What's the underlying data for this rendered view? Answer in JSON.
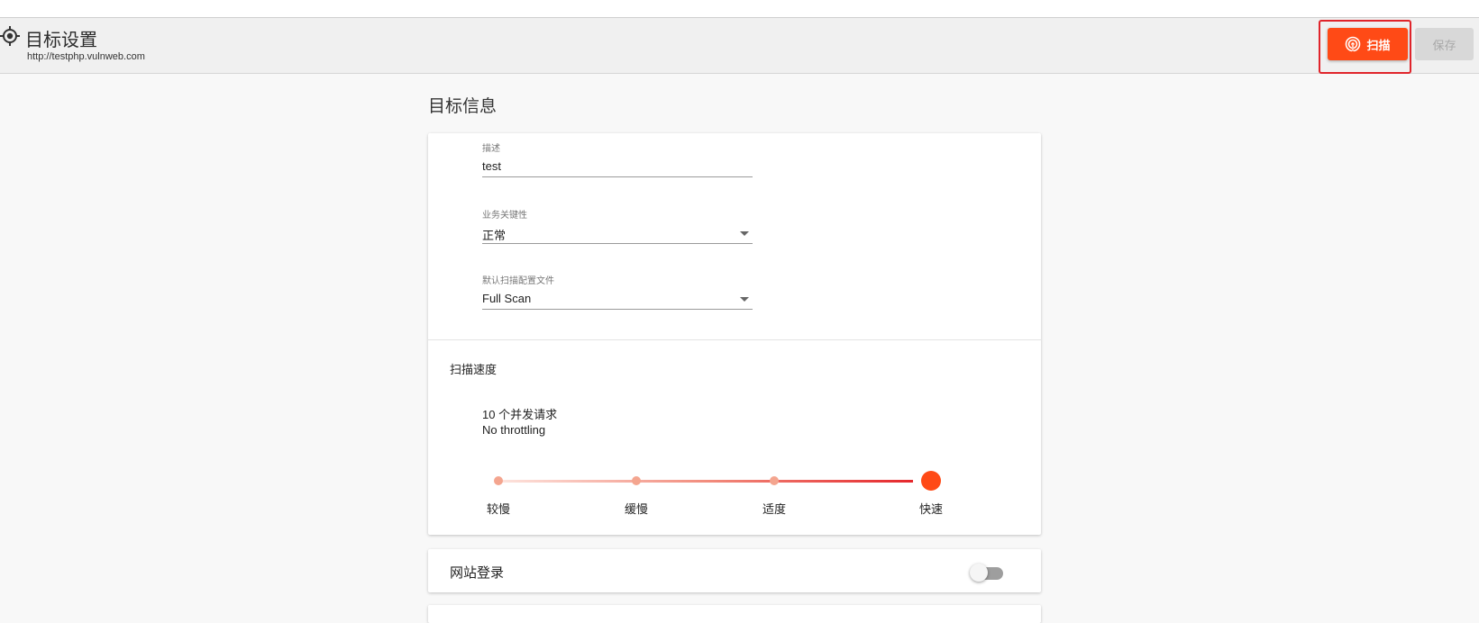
{
  "header": {
    "title": "目标设置",
    "url": "http://testphp.vulnweb.com",
    "scan_label": "扫描",
    "save_label": "保存"
  },
  "section_title": "目标信息",
  "fields": {
    "description": {
      "label": "描述",
      "value": "test"
    },
    "criticality": {
      "label": "业务关键性",
      "value": "正常"
    },
    "profile": {
      "label": "默认扫描配置文件",
      "value": "Full Scan"
    }
  },
  "speed": {
    "title": "扫描速度",
    "line1": "10 个并发请求",
    "line2": "No throttling",
    "levels": [
      "较慢",
      "缓慢",
      "适度",
      "快速"
    ],
    "selected": "快速"
  },
  "login": {
    "title": "网站登录",
    "enabled": false
  },
  "colors": {
    "accent": "#ff4a16",
    "highlight_border": "#e0242b"
  },
  "icons": {
    "target": "target-icon",
    "scan": "radar-icon"
  }
}
